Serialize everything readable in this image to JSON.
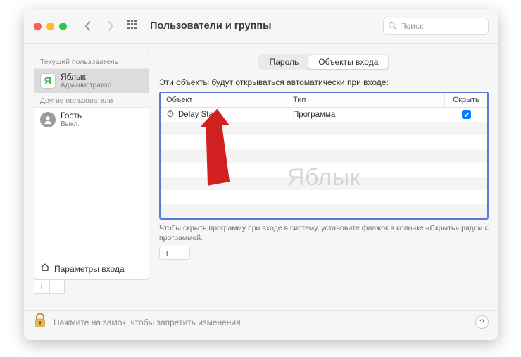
{
  "header": {
    "title": "Пользователи и группы",
    "search_placeholder": "Поиск"
  },
  "sidebar": {
    "section_current": "Текущий пользователь",
    "section_other": "Другие пользователи",
    "current": {
      "avatar_letter": "Я",
      "name": "Яблык",
      "role": "Администратор"
    },
    "guest": {
      "name": "Гость",
      "status": "Выкл."
    },
    "login_options_label": "Параметры входа"
  },
  "main": {
    "tabs": {
      "password": "Пароль",
      "login_items": "Объекты входа"
    },
    "description": "Эти объекты будут открываться автоматически при входе:",
    "columns": {
      "object": "Объект",
      "type": "Тип",
      "hide": "Скрыть"
    },
    "rows": [
      {
        "name": "Delay Start",
        "type": "Программа",
        "hide": true
      }
    ],
    "watermark": "Яблык",
    "hint": "Чтобы скрыть программу при входе в систему, установите флажок в колонке «Скрыть» рядом с программой."
  },
  "footer": {
    "text": "Нажмите на замок, чтобы запретить изменения."
  }
}
